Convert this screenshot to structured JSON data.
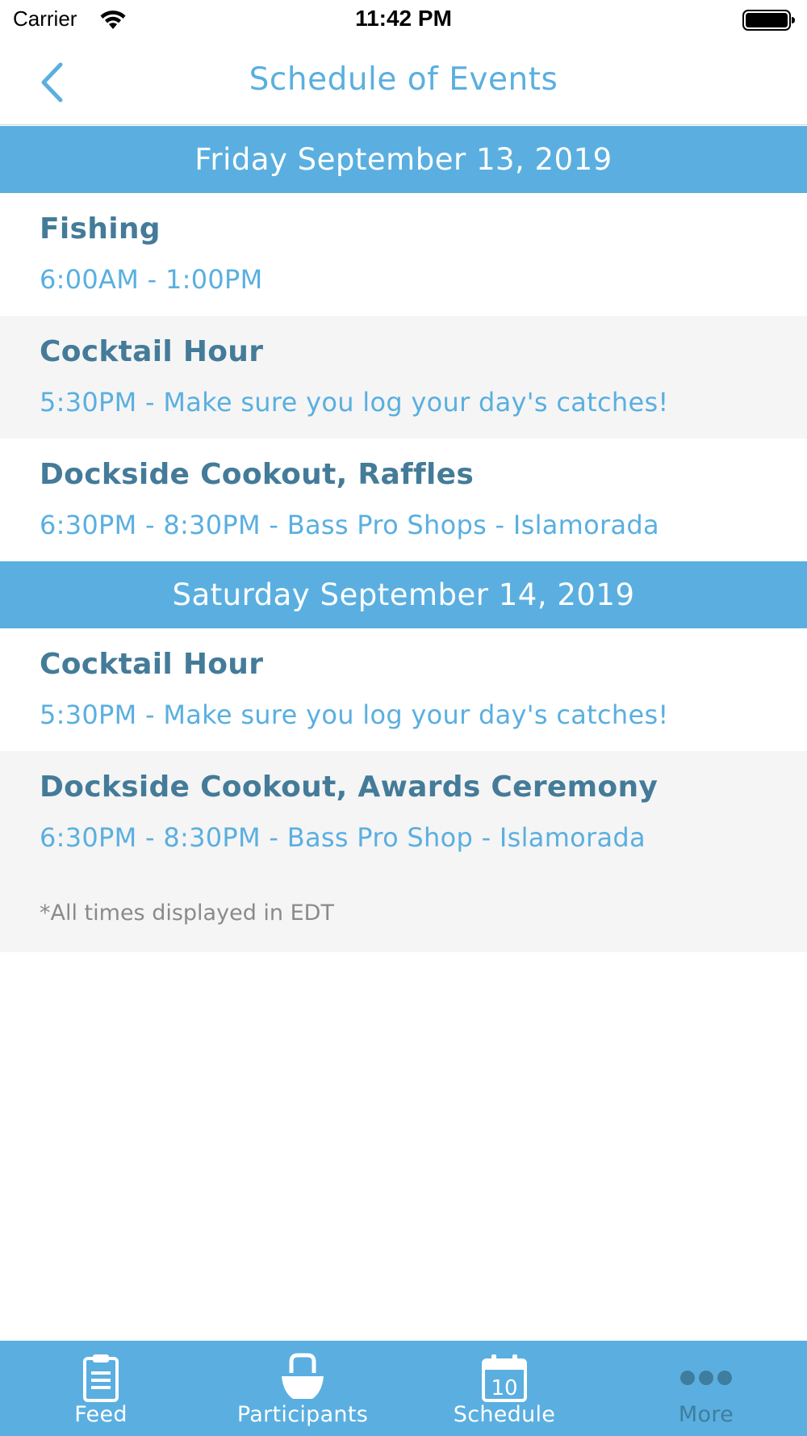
{
  "status_bar": {
    "carrier": "Carrier",
    "time": "11:42 PM"
  },
  "nav": {
    "title": "Schedule of Events"
  },
  "days": [
    {
      "header": "Friday September 13, 2019",
      "events": [
        {
          "title": "Fishing",
          "detail": "6:00AM - 1:00PM"
        },
        {
          "title": "Cocktail Hour",
          "detail": "5:30PM - Make sure you log your day's catches!"
        },
        {
          "title": "Dockside Cookout, Raffles",
          "detail": "6:30PM - 8:30PM - Bass Pro Shops - Islamorada"
        }
      ]
    },
    {
      "header": "Saturday September 14, 2019",
      "events": [
        {
          "title": "Cocktail Hour",
          "detail": "5:30PM - Make sure you log your day's catches!"
        },
        {
          "title": "Dockside Cookout, Awards Ceremony",
          "detail": "6:30PM - 8:30PM - Bass Pro Shop - Islamorada"
        }
      ]
    }
  ],
  "footnote": "*All times displayed in EDT",
  "tabs": [
    {
      "label": "Feed",
      "icon": "clipboard-icon"
    },
    {
      "label": "Participants",
      "icon": "participant-icon"
    },
    {
      "label": "Schedule",
      "icon": "calendar-icon",
      "icon_text": "10"
    },
    {
      "label": "More",
      "icon": "more-dots-icon"
    }
  ],
  "colors": {
    "accent": "#5aafe0",
    "title_text": "#447b99",
    "inactive_tab": "#3f7d9e",
    "alt_row": "#f5f5f5"
  }
}
